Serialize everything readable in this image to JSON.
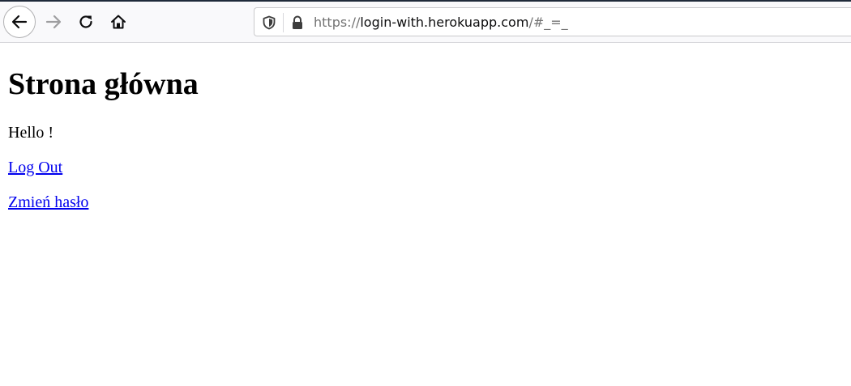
{
  "browser": {
    "url": {
      "scheme": "https://",
      "host": "login-with.herokuapp.com",
      "path": "/#_=_"
    },
    "icons": {
      "back": "arrow-left-icon",
      "forward": "arrow-right-icon",
      "reload": "reload-icon",
      "home": "home-icon",
      "tracking_protection": "shield-icon",
      "security": "lock-icon"
    },
    "colors": {
      "toolbar_bg": "#f9f9fb",
      "icon_active": "#0c0c0d",
      "icon_disabled": "#9e9ea0"
    }
  },
  "page": {
    "title": "Strona główna",
    "greeting": "Hello !",
    "links": {
      "logout": "Log Out",
      "change_password": "Zmień hasło"
    },
    "colors": {
      "link": "#0000ee",
      "text": "#000000"
    }
  }
}
